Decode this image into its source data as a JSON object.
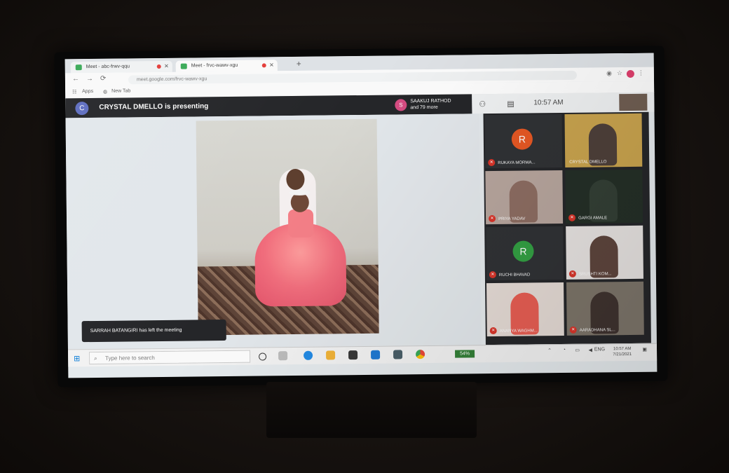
{
  "browser": {
    "tabs": [
      {
        "label": "Meet - abc-frwv-qqu"
      },
      {
        "label": "Meet - frvc-wawv-xgu"
      }
    ],
    "url": "meet.google.com/frvc-wawv-xgu",
    "bookmarks": [
      "Apps",
      "New Tab"
    ]
  },
  "meeting": {
    "presenter_initial": "C",
    "presenting_text": "CRYSTAL DMELLO is presenting",
    "participants_avatar": "S",
    "participants_name": "SAAKUJ RATHOD",
    "participants_more": "and 79 more",
    "clock": "10:57 AM",
    "toast": "SARRAH BATANGIRI has left the meeting"
  },
  "participants": [
    {
      "name": "RUKAYA MORWA...",
      "initial": "R",
      "color": "#e8541e"
    },
    {
      "name": "CRYSTAL DMELLO",
      "initial": "",
      "color": ""
    },
    {
      "name": "PRIYA YADAV",
      "initial": "",
      "color": ""
    },
    {
      "name": "GARGI AMALE",
      "initial": "",
      "color": ""
    },
    {
      "name": "RUCHI BHAVAD",
      "initial": "R",
      "color": "#2e9e3e"
    },
    {
      "name": "SRUSHTI KOM...",
      "initial": "",
      "color": ""
    },
    {
      "name": "ANANYA WAGHM...",
      "initial": "",
      "color": ""
    },
    {
      "name": "AARADHANA SL...",
      "initial": "",
      "color": ""
    }
  ],
  "taskbar": {
    "search_placeholder": "Type here to search",
    "badge": "54%",
    "time": "10:57 AM",
    "date": "7/21/2021"
  }
}
